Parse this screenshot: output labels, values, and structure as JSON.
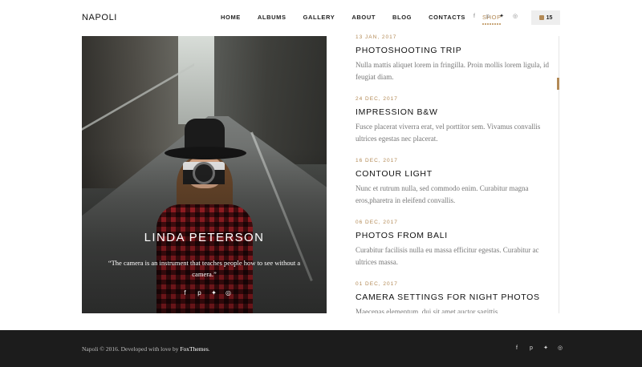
{
  "header": {
    "logo": "NAPOLI",
    "nav": [
      "HOME",
      "ALBUMS",
      "GALLERY",
      "ABOUT",
      "BLOG",
      "CONTACTS",
      "SHOP"
    ],
    "active_nav": "SHOP",
    "social": [
      "facebook-icon",
      "pinterest-icon",
      "twitter-icon",
      "dribbble-icon"
    ],
    "cart_count": "15"
  },
  "profile": {
    "name": "LINDA PETERSON",
    "quote": "“The camera is an instrument that teaches people how to see without a camera.”",
    "social": [
      "facebook-icon",
      "pinterest-icon",
      "twitter-icon",
      "dribbble-icon"
    ]
  },
  "posts": [
    {
      "date": "13 JAN, 2017",
      "title": "PHOTOSHOOTING TRIP",
      "excerpt": "Nulla mattis aliquet lorem in fringilla. Proin mollis lorem ligula, id feugiat diam."
    },
    {
      "date": "24 DEC, 2017",
      "title": "IMPRESSION B&W",
      "excerpt": "Fusce placerat viverra erat, vel porttitor sem. Vivamus convallis ultrices egestas nec placerat."
    },
    {
      "date": "16 DEC, 2017",
      "title": "CONTOUR LIGHT",
      "excerpt": "Nunc et rutrum nulla, sed commodo enim. Curabitur magna eros,pharetra in eleifend convallis."
    },
    {
      "date": "06 DEC, 2017",
      "title": "PHOTOS FROM BALI",
      "excerpt": "Curabitur facilisis nulla eu massa efficitur egestas. Curabitur ac ultrices massa."
    },
    {
      "date": "01 DEC, 2017",
      "title": "CAMERA SETTINGS FOR NIGHT PHOTOS",
      "excerpt": "Maecenas elementum, dui sit amet auctor sagittis"
    }
  ],
  "footer": {
    "text": "Napoli © 2016. Developed with love by ",
    "link": "FoxThemes",
    "suffix": ".",
    "social": [
      "facebook-icon",
      "pinterest-icon",
      "twitter-icon",
      "dribbble-icon"
    ]
  },
  "colors": {
    "accent": "#b38a56",
    "footer_bg": "#1c1c1c"
  }
}
